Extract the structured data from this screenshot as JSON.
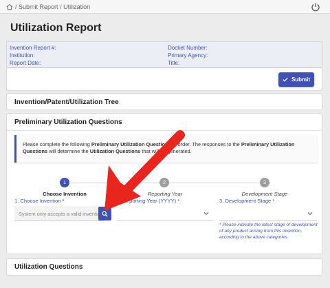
{
  "breadcrumb": {
    "sep": "/",
    "items": [
      "Submit Report",
      "Utilization"
    ],
    "home_icon": "home-icon"
  },
  "power_icon": "power-icon",
  "page_title": "Utilization Report",
  "info": {
    "left": [
      "Invention Report #:",
      "Institution:",
      "Report Date:"
    ],
    "right": [
      "Docket Number:",
      "Primary Agency:",
      "Title:"
    ]
  },
  "submit": {
    "label": "Submit",
    "icon": "check-icon"
  },
  "sections": {
    "tree": "Invention/Patent/Utilization Tree",
    "prelim": "Preliminary Utilization Questions",
    "utilization": "Utilization Questions"
  },
  "notice": {
    "t1": "Please complete the following ",
    "b1": "Preliminary Utilization Questions",
    "t2": " in order. The responses to the ",
    "b2": "Preliminary Utilization Questions",
    "t3": " will determine the ",
    "b3": "Utilization Questions",
    "t4": " that will be generated."
  },
  "steps": [
    {
      "num": "1",
      "name": "Choose Invention",
      "field_label": "1. Choose Invention *",
      "state": "active"
    },
    {
      "num": "2",
      "name": "Reporting Year",
      "field_label": "2. Reporting Year (YYYY) *",
      "state": "inactive"
    },
    {
      "num": "3",
      "name": "Development Stage",
      "field_label": "3. Development Stage *",
      "state": "inactive"
    }
  ],
  "invention_input": {
    "placeholder": "System only accepts a valid invention",
    "value": ""
  },
  "search_icon": "search-icon",
  "stage_note": "* Please indicate the latest stage of development of any product arising from this invention, according to the above categories.",
  "colors": {
    "accent": "#3f51b5",
    "step_inactive": "#9e9e9e",
    "annotation_arrow": "#e8261e"
  }
}
